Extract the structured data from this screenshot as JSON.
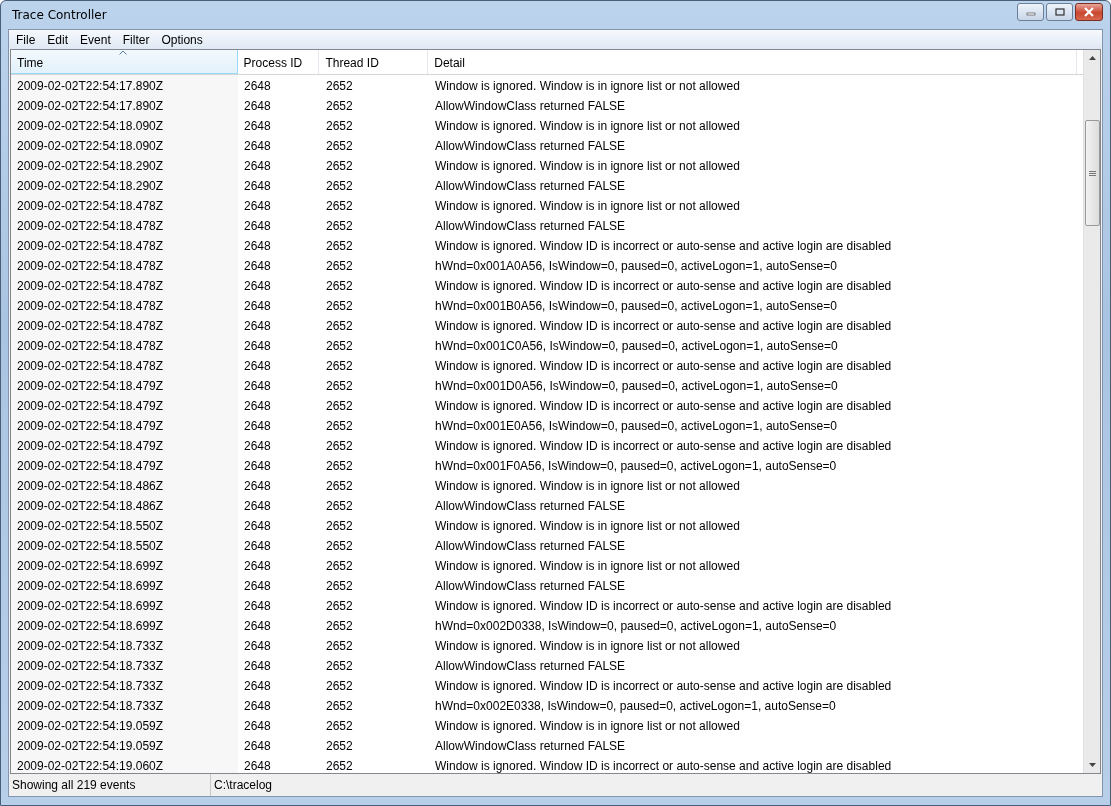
{
  "window": {
    "title": "Trace Controller"
  },
  "menu": [
    "File",
    "Edit",
    "Event",
    "Filter",
    "Options"
  ],
  "table": {
    "columns": [
      {
        "label": "Time",
        "sorted": true
      },
      {
        "label": "Process ID",
        "sorted": false
      },
      {
        "label": "Thread ID",
        "sorted": false
      },
      {
        "label": "Detail",
        "sorted": false
      }
    ],
    "rows": [
      [
        "2009-02-02T22:54:17.890Z",
        "2648",
        "2652",
        "Window is ignored. Window is in ignore list or not allowed"
      ],
      [
        "2009-02-02T22:54:17.890Z",
        "2648",
        "2652",
        "AllowWindowClass returned FALSE"
      ],
      [
        "2009-02-02T22:54:18.090Z",
        "2648",
        "2652",
        "Window is ignored. Window is in ignore list or not allowed"
      ],
      [
        "2009-02-02T22:54:18.090Z",
        "2648",
        "2652",
        "AllowWindowClass returned FALSE"
      ],
      [
        "2009-02-02T22:54:18.290Z",
        "2648",
        "2652",
        "Window is ignored. Window is in ignore list or not allowed"
      ],
      [
        "2009-02-02T22:54:18.290Z",
        "2648",
        "2652",
        "AllowWindowClass returned FALSE"
      ],
      [
        "2009-02-02T22:54:18.478Z",
        "2648",
        "2652",
        "Window is ignored. Window is in ignore list or not allowed"
      ],
      [
        "2009-02-02T22:54:18.478Z",
        "2648",
        "2652",
        "AllowWindowClass returned FALSE"
      ],
      [
        "2009-02-02T22:54:18.478Z",
        "2648",
        "2652",
        "Window is ignored. Window ID is incorrect or auto-sense and active login are disabled"
      ],
      [
        "2009-02-02T22:54:18.478Z",
        "2648",
        "2652",
        "hWnd=0x001A0A56, IsWindow=0, paused=0, activeLogon=1, autoSense=0"
      ],
      [
        "2009-02-02T22:54:18.478Z",
        "2648",
        "2652",
        "Window is ignored. Window ID is incorrect or auto-sense and active login are disabled"
      ],
      [
        "2009-02-02T22:54:18.478Z",
        "2648",
        "2652",
        "hWnd=0x001B0A56, IsWindow=0, paused=0, activeLogon=1, autoSense=0"
      ],
      [
        "2009-02-02T22:54:18.478Z",
        "2648",
        "2652",
        "Window is ignored. Window ID is incorrect or auto-sense and active login are disabled"
      ],
      [
        "2009-02-02T22:54:18.478Z",
        "2648",
        "2652",
        "hWnd=0x001C0A56, IsWindow=0, paused=0, activeLogon=1, autoSense=0"
      ],
      [
        "2009-02-02T22:54:18.478Z",
        "2648",
        "2652",
        "Window is ignored. Window ID is incorrect or auto-sense and active login are disabled"
      ],
      [
        "2009-02-02T22:54:18.479Z",
        "2648",
        "2652",
        "hWnd=0x001D0A56, IsWindow=0, paused=0, activeLogon=1, autoSense=0"
      ],
      [
        "2009-02-02T22:54:18.479Z",
        "2648",
        "2652",
        "Window is ignored. Window ID is incorrect or auto-sense and active login are disabled"
      ],
      [
        "2009-02-02T22:54:18.479Z",
        "2648",
        "2652",
        "hWnd=0x001E0A56, IsWindow=0, paused=0, activeLogon=1, autoSense=0"
      ],
      [
        "2009-02-02T22:54:18.479Z",
        "2648",
        "2652",
        "Window is ignored. Window ID is incorrect or auto-sense and active login are disabled"
      ],
      [
        "2009-02-02T22:54:18.479Z",
        "2648",
        "2652",
        "hWnd=0x001F0A56, IsWindow=0, paused=0, activeLogon=1, autoSense=0"
      ],
      [
        "2009-02-02T22:54:18.486Z",
        "2648",
        "2652",
        "Window is ignored. Window is in ignore list or not allowed"
      ],
      [
        "2009-02-02T22:54:18.486Z",
        "2648",
        "2652",
        "AllowWindowClass returned FALSE"
      ],
      [
        "2009-02-02T22:54:18.550Z",
        "2648",
        "2652",
        "Window is ignored. Window is in ignore list or not allowed"
      ],
      [
        "2009-02-02T22:54:18.550Z",
        "2648",
        "2652",
        "AllowWindowClass returned FALSE"
      ],
      [
        "2009-02-02T22:54:18.699Z",
        "2648",
        "2652",
        "Window is ignored. Window is in ignore list or not allowed"
      ],
      [
        "2009-02-02T22:54:18.699Z",
        "2648",
        "2652",
        "AllowWindowClass returned FALSE"
      ],
      [
        "2009-02-02T22:54:18.699Z",
        "2648",
        "2652",
        "Window is ignored. Window ID is incorrect or auto-sense and active login are disabled"
      ],
      [
        "2009-02-02T22:54:18.699Z",
        "2648",
        "2652",
        "hWnd=0x002D0338, IsWindow=0, paused=0, activeLogon=1, autoSense=0"
      ],
      [
        "2009-02-02T22:54:18.733Z",
        "2648",
        "2652",
        "Window is ignored. Window is in ignore list or not allowed"
      ],
      [
        "2009-02-02T22:54:18.733Z",
        "2648",
        "2652",
        "AllowWindowClass returned FALSE"
      ],
      [
        "2009-02-02T22:54:18.733Z",
        "2648",
        "2652",
        "Window is ignored. Window ID is incorrect or auto-sense and active login are disabled"
      ],
      [
        "2009-02-02T22:54:18.733Z",
        "2648",
        "2652",
        "hWnd=0x002E0338, IsWindow=0, paused=0, activeLogon=1, autoSense=0"
      ],
      [
        "2009-02-02T22:54:19.059Z",
        "2648",
        "2652",
        "Window is ignored. Window is in ignore list or not allowed"
      ],
      [
        "2009-02-02T22:54:19.059Z",
        "2648",
        "2652",
        "AllowWindowClass returned FALSE"
      ],
      [
        "2009-02-02T22:54:19.060Z",
        "2648",
        "2652",
        "Window is ignored. Window ID is incorrect or auto-sense and active login are disabled"
      ]
    ]
  },
  "status_bar": [
    "Showing all 219 events",
    "C:\\tracelog"
  ]
}
